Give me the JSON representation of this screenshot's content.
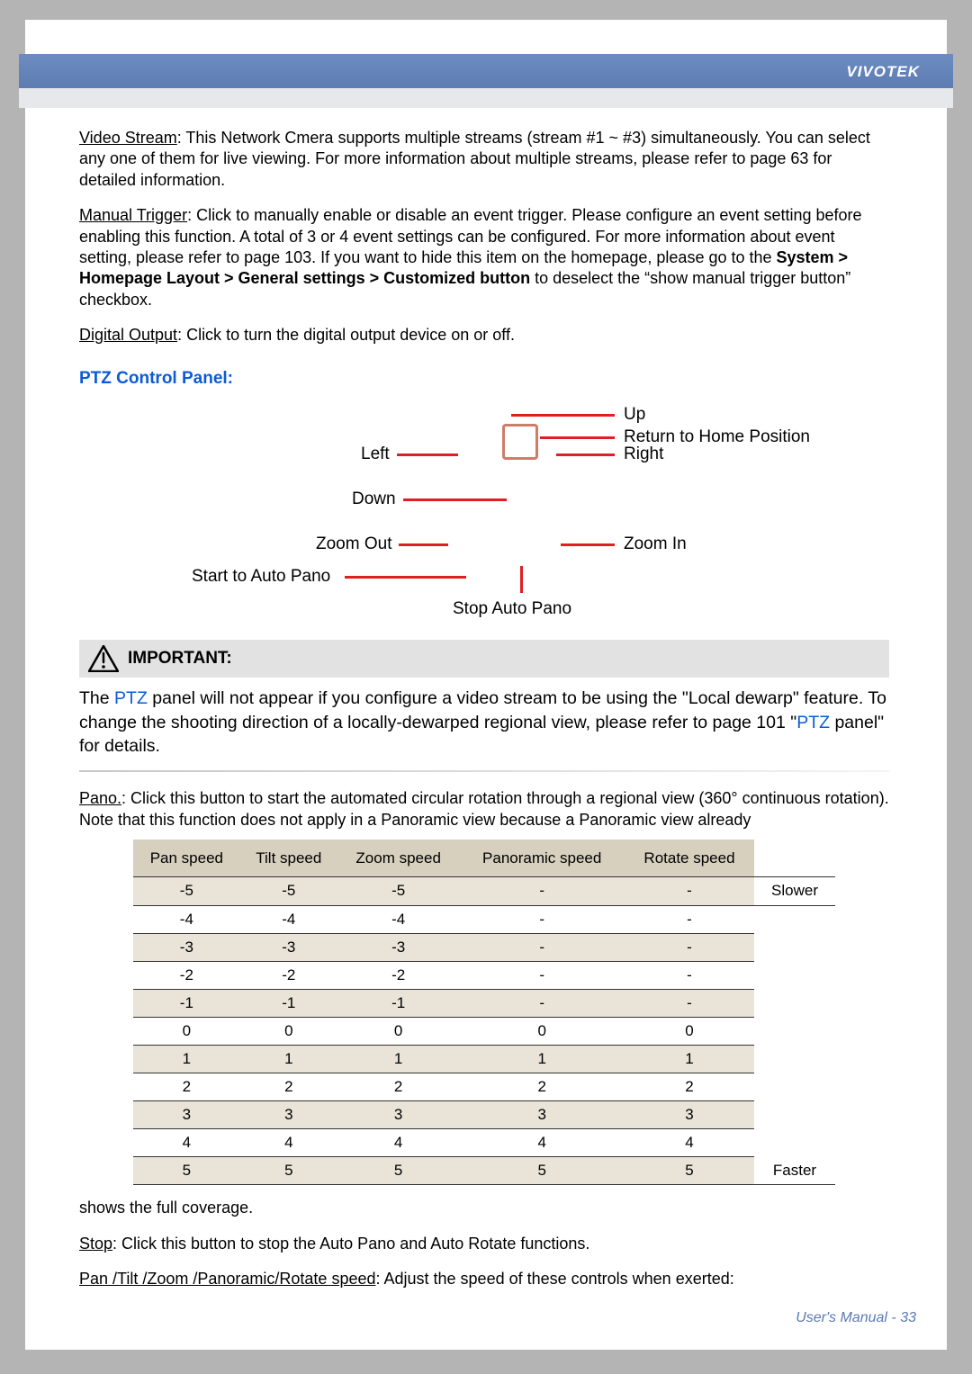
{
  "brand": "VIVOTEK",
  "sections": {
    "video_stream": {
      "label": "Video Stream",
      "text": ": This Network Cmera supports multiple streams (stream #1 ~ #3) simultaneously. You can select any one of them for live viewing. For more information about multiple streams, please refer to page 63 for detailed information."
    },
    "manual_trigger": {
      "label": "Manual Trigger",
      "text_a": ": Click to manually enable or disable an event trigger. Please configure an event setting before enabling this function. A total of 3 or 4 event settings can be configured. For more information about event setting, please refer to page 103. If you want to hide this item on the homepage, please go to the ",
      "path": "System > Homepage Layout > General settings > Customized button",
      "text_b": " to deselect the “show manual trigger button” checkbox."
    },
    "digital_output": {
      "label": "Digital Output",
      "text": ": Click to turn the digital output device on or off."
    },
    "ptz_heading": "PTZ Control Panel:",
    "ptz_labels": {
      "up": "Up",
      "return_home": "Return to Home Position",
      "left": "Left",
      "right": "Right",
      "down": "Down",
      "zoom_out": "Zoom Out",
      "zoom_in": "Zoom In",
      "start_auto_pano": "Start to Auto Pano",
      "stop_auto_pano": "Stop Auto Pano"
    },
    "important": {
      "heading": "IMPORTANT:",
      "before": "The ",
      "link1": "PTZ",
      "mid": " panel will not appear if you configure a video stream to be using the \"Local dewarp\" feature. To change the shooting direction of a locally-dewarped regional view, please refer to page 101 \"",
      "link2": "PTZ",
      "after": " panel\" for details."
    },
    "pano": {
      "label": "Pano.",
      "text": ": Click this button to start the automated circular rotation through a regional view (360° continuous rotation). Note that this function does not apply in a Panoramic view because a Panoramic view already"
    },
    "after_table": "shows the full coverage.",
    "stop": {
      "label": "Stop",
      "text": ": Click this button to stop the Auto Pano and Auto Rotate functions."
    },
    "speed_desc": {
      "label": "Pan /Tilt /Zoom /Panoramic/Rotate speed",
      "text": ": Adjust the speed of these controls when exerted:"
    }
  },
  "speed_table": {
    "headers": [
      "Pan speed",
      "Tilt speed",
      "Zoom speed",
      "Panoramic speed",
      "Rotate speed",
      ""
    ],
    "slower": "Slower",
    "faster": "Faster",
    "rows": [
      [
        "-5",
        "-5",
        "-5",
        "-",
        "-"
      ],
      [
        "-4",
        "-4",
        "-4",
        "-",
        "-"
      ],
      [
        "-3",
        "-3",
        "-3",
        "-",
        "-"
      ],
      [
        "-2",
        "-2",
        "-2",
        "-",
        "-"
      ],
      [
        "-1",
        "-1",
        "-1",
        "-",
        "-"
      ],
      [
        "0",
        "0",
        "0",
        "0",
        "0"
      ],
      [
        "1",
        "1",
        "1",
        "1",
        "1"
      ],
      [
        "2",
        "2",
        "2",
        "2",
        "2"
      ],
      [
        "3",
        "3",
        "3",
        "3",
        "3"
      ],
      [
        "4",
        "4",
        "4",
        "4",
        "4"
      ],
      [
        "5",
        "5",
        "5",
        "5",
        "5"
      ]
    ]
  },
  "footer": "User's Manual - 33"
}
